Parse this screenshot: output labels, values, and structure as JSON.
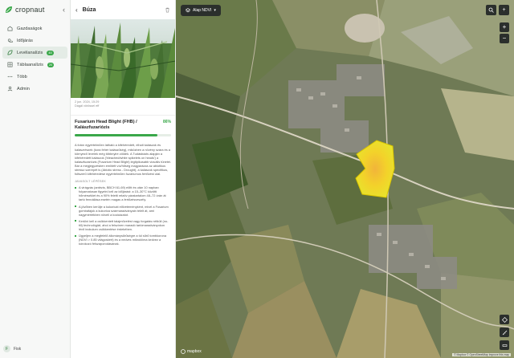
{
  "brand": {
    "name": "cropnaut",
    "collapse_icon": "chevron-left-icon"
  },
  "nav": {
    "items": [
      {
        "label": "Gazdaságok",
        "icon": "farm-icon",
        "active": false
      },
      {
        "label": "Időjárás",
        "icon": "weather-icon",
        "active": false
      },
      {
        "label": "Levélanalízis",
        "icon": "leaf-analysis-icon",
        "active": true,
        "badge": "45"
      },
      {
        "label": "Táblaanalízis",
        "icon": "field-analysis-icon",
        "active": false,
        "badge": "20"
      },
      {
        "label": "Több",
        "icon": "more-icon",
        "active": false
      },
      {
        "label": "Admin",
        "icon": "admin-icon",
        "active": false
      }
    ]
  },
  "user": {
    "initial": "F",
    "name": "Fisk"
  },
  "panel": {
    "title": "Búza",
    "meta_line1": "2 jun. 2024, 15:29",
    "meta_line2": "Dágál vörössel eff",
    "analysis": {
      "title": "Fusarium Head Blight (FHB) / Kalászfuzariózis",
      "percent": "86%",
      "percent_value": 0.86
    },
    "description": "A fotón egyértelműen látható a kifehéredett, elhalt kalászok és kalászrészek (kora fehér kalászűség), miközben a növény szára és a környező levelek még többnyire zöldek. A Tudásbázis alapján a kifehéredett kalászok ('bleached/white spikelets on heads') a kalászfuzariózis (Fusarium Head Blight) legtipikusabb vizuális tünetei. Bár a megjegyzésben említett víz/hőség magyarázza az abiotikus stressz szerepét is (Abiotic stress - Drought), a kalászok specifikus, foltszerű kifehéredése egyértelműen fuzáriumos fertőzést utal.",
    "sub_label": "JAVASOLT LÉPÉSEK",
    "bullets": [
      "A virágzás (antézis, BBCH 61-69) előtt és után 10 napban folyamatosan figyelni kell az időjárást: a 15–30°C közötti hőmérséklet és a 90% feletti relatív páratartalom 48–72 órán át tartó fennállása esetén magas a fertőzésveszély.",
      "A jövőben kerülje a kukoricát előveteményként, mivel a Fusarium gombafajok a kukorica szármaradványain telelt át, ami nagymértékben növeli a kockázatot.",
      "Kerülni kell a csökkentett talajművelést vagy forgatás nélküli (no-till) technológiát, ahol a felszínen maradó tarlómaradványokon lévő inokulum csökkentése érdekében.",
      "Ügyeljen a megfelelő állománysűrűségre a túl sűrű tombkorona (NDVI > 0.85 világoskért) és a nedves mikroklíma kedvez a kórokozó felszaporodásának."
    ]
  },
  "map": {
    "layer_label": "Alap NDVI",
    "layer_icon": "layers-icon",
    "search_icon": "search-icon",
    "add_icon": "plus-icon",
    "zoom_in": "+",
    "zoom_out": "−",
    "tool_icons": [
      "diamond-icon",
      "ruler-icon",
      "measure-icon"
    ],
    "logo_text": "mapbox",
    "attribution": "© Mapbox © OpenStreetMap Improve this map"
  }
}
